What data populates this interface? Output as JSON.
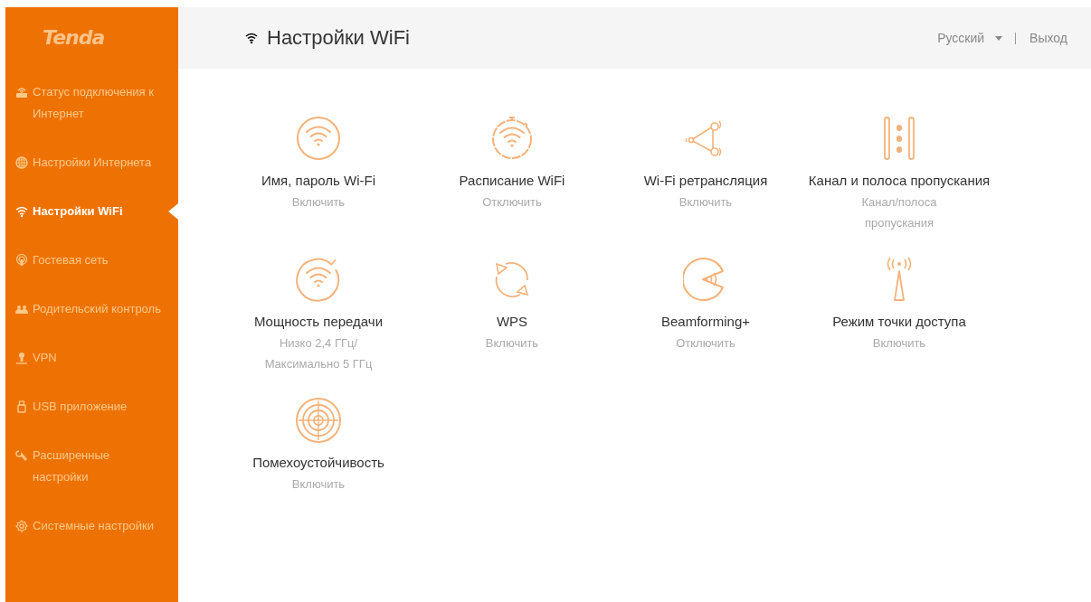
{
  "logo": "Tenda",
  "sidebar": {
    "items": [
      {
        "label": "Статус подключения к Интернет",
        "selected": false
      },
      {
        "label": "Настройки Интернета",
        "selected": false
      },
      {
        "label": "Настройки WiFi",
        "selected": true
      },
      {
        "label": "Гостевая сеть",
        "selected": false
      },
      {
        "label": "Родительский контроль",
        "selected": false
      },
      {
        "label": "VPN",
        "selected": false
      },
      {
        "label": "USB приложение",
        "selected": false
      },
      {
        "label": "Расширенные настройки",
        "selected": false
      },
      {
        "label": "Системные настройки",
        "selected": false
      }
    ]
  },
  "header": {
    "title": "Настройки WiFi",
    "language": "Русский",
    "logout": "Выход"
  },
  "tiles": [
    {
      "title": "Имя, пароль Wi-Fi",
      "status": "Включить"
    },
    {
      "title": "Расписание WiFi",
      "status": "Отключить"
    },
    {
      "title": "Wi-Fi ретрансляция",
      "status": "Включить"
    },
    {
      "title": "Канал и полоса пропускания",
      "status": "Канал/полоса пропускания"
    },
    {
      "title": "Мощность передачи",
      "status": "Низко 2,4 ГГц/ Максимально 5 ГГц"
    },
    {
      "title": "WPS",
      "status": "Включить"
    },
    {
      "title": "Beamforming+",
      "status": "Отключить"
    },
    {
      "title": "Режим точки доступа",
      "status": "Включить"
    },
    {
      "title": "Помехоустойчивость",
      "status": "Включить"
    }
  ]
}
